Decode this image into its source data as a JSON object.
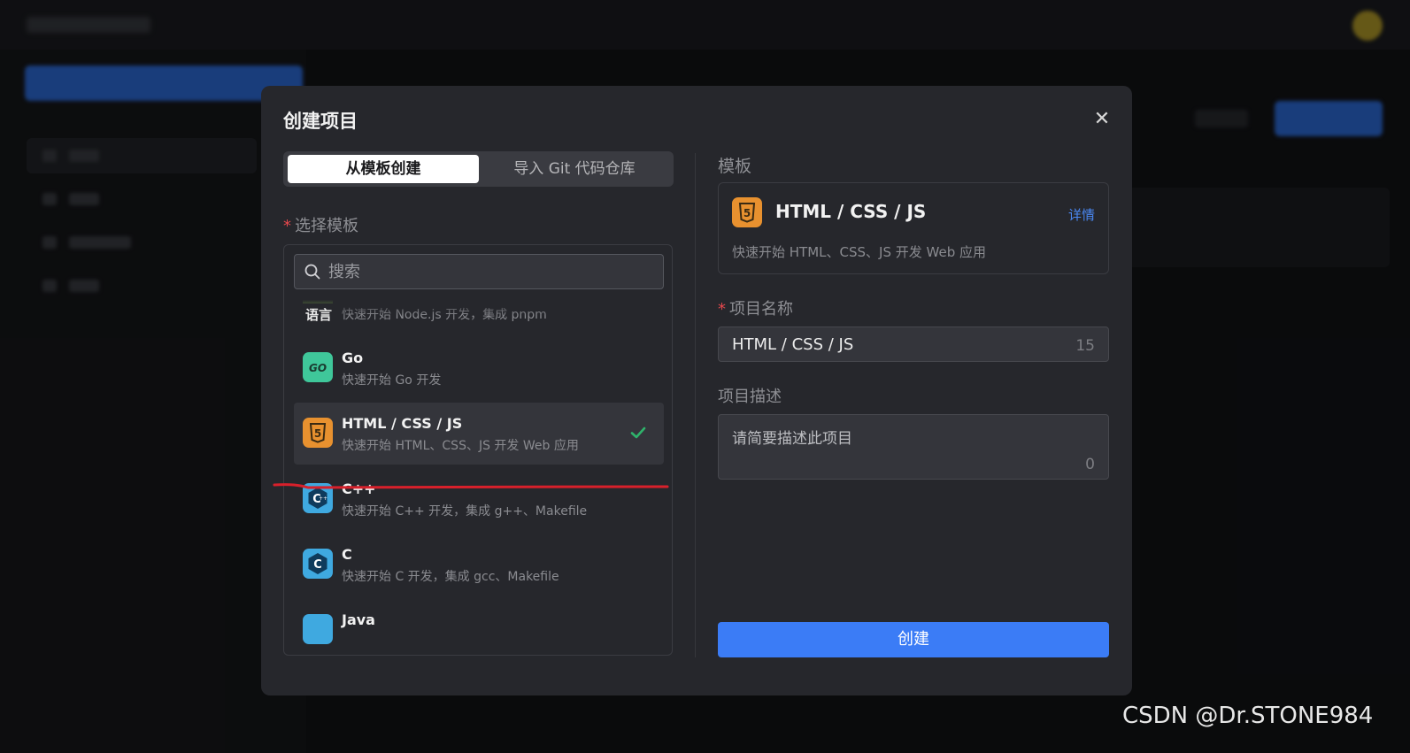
{
  "modal": {
    "title": "创建项目",
    "tabs": [
      {
        "label": "从模板创建",
        "active": true
      },
      {
        "label": "导入 Git 代码仓库",
        "active": false
      }
    ]
  },
  "left": {
    "select_label": "选择模板",
    "search_placeholder": "搜索",
    "group_label": "语言",
    "items": [
      {
        "title": "",
        "desc": "快速开始 Node.js 开发，集成 pnpm",
        "icon": "nodejs-icon"
      },
      {
        "title": "Go",
        "desc": "快速开始 Go 开发",
        "icon": "go-icon",
        "icon_text": "GO"
      },
      {
        "title": "HTML / CSS / JS",
        "desc": "快速开始 HTML、CSS、JS 开发 Web 应用",
        "icon": "html5-icon",
        "icon_text": "5",
        "selected": true
      },
      {
        "title": "C++",
        "desc": "快速开始 C++ 开发，集成 g++、Makefile",
        "icon": "cpp-icon",
        "icon_text": "C"
      },
      {
        "title": "C",
        "desc": "快速开始 C 开发，集成 gcc、Makefile",
        "icon": "c-icon",
        "icon_text": "C"
      },
      {
        "title": "Java",
        "desc": "",
        "icon": "java-icon"
      }
    ]
  },
  "right": {
    "template_label": "模板",
    "template_title": "HTML / CSS / JS",
    "template_link": "详情",
    "template_desc": "快速开始 HTML、CSS、JS 开发 Web 应用",
    "name_label": "项目名称",
    "name_value": "HTML / CSS / JS",
    "name_count": "15",
    "desc_label": "项目描述",
    "desc_placeholder": "请简要描述此项目",
    "desc_count": "0",
    "create_label": "创建"
  },
  "watermark": "CSDN @Dr.STONE984",
  "colors": {
    "accent": "#3b7cf6",
    "html5": "#e8912f",
    "go": "#3fc79a",
    "cpp": "#3fa9e0",
    "check": "#2fb36b",
    "annotation": "#d8202b"
  }
}
